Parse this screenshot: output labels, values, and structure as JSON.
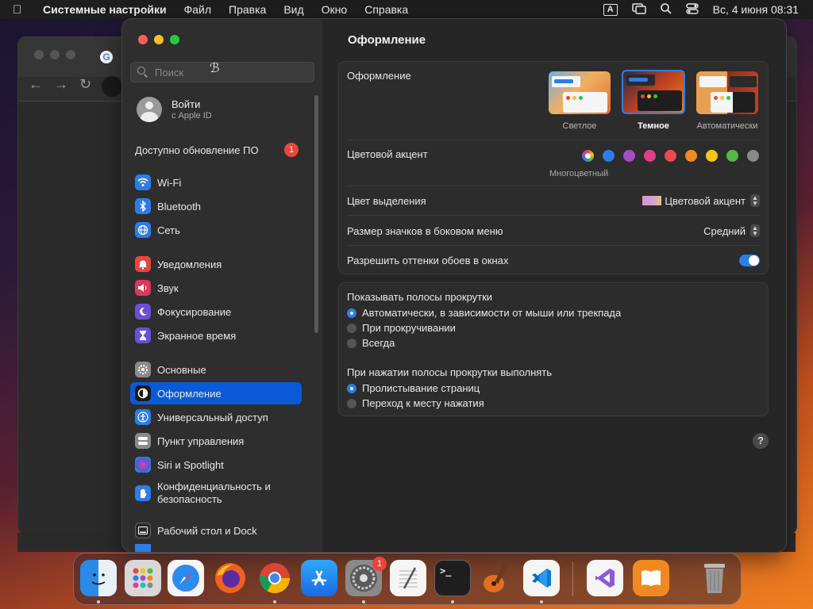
{
  "menubar": {
    "app_name": "Системные настройки",
    "items": [
      "Файл",
      "Правка",
      "Вид",
      "Окно",
      "Справка"
    ],
    "input_source": "A",
    "datetime": "Вс, 4 июня  08:31"
  },
  "sidebar": {
    "search_placeholder": "Поиск",
    "account": {
      "title": "Войти",
      "subtitle": "с Apple ID"
    },
    "update": {
      "label": "Доступно обновление ПО",
      "count": "1"
    },
    "items": [
      {
        "label": "Wi‑Fi",
        "icon": "wifi-icon",
        "color": "#2d7de8"
      },
      {
        "label": "Bluetooth",
        "icon": "bluetooth-icon",
        "color": "#2d7de8"
      },
      {
        "label": "Сеть",
        "icon": "globe-icon",
        "color": "#2d7de8"
      },
      {
        "label": "Уведомления",
        "icon": "bell-icon",
        "color": "#e8453c"
      },
      {
        "label": "Звук",
        "icon": "speaker-icon",
        "color": "#e0385a"
      },
      {
        "label": "Фокусирование",
        "icon": "moon-icon",
        "color": "#6a4fd8"
      },
      {
        "label": "Экранное время",
        "icon": "hourglass-icon",
        "color": "#6a4fd8"
      },
      {
        "label": "Основные",
        "icon": "gear-icon",
        "color": "#8a8a8a"
      },
      {
        "label": "Оформление",
        "icon": "appearance-icon",
        "color": "#1a1a1a"
      },
      {
        "label": "Универсальный доступ",
        "icon": "accessibility-icon",
        "color": "#2d7de8"
      },
      {
        "label": "Пункт управления",
        "icon": "control-center-icon",
        "color": "#8a8a8a"
      },
      {
        "label": "Siri и Spotlight",
        "icon": "siri-icon",
        "color": "#b04ad0"
      },
      {
        "label": "Конфиденциальность и безопасность",
        "icon": "hand-icon",
        "color": "#2d7de8"
      },
      {
        "label": "Рабочий стол и Dock",
        "icon": "dock-icon",
        "color": "#2a2a2a"
      }
    ]
  },
  "main": {
    "title": "Оформление",
    "appearance": {
      "label": "Оформление",
      "options": [
        "Светлое",
        "Темное",
        "Автоматически"
      ],
      "selected": "Темное"
    },
    "accent": {
      "label": "Цветовой акцент",
      "caption": "Многоцветный",
      "colors": [
        "#2d7de8",
        "#a050c0",
        "#e0408a",
        "#ec4a50",
        "#f08a20",
        "#f5c518",
        "#54b848",
        "#8a8a8a"
      ]
    },
    "highlight": {
      "label": "Цвет выделения",
      "value": "Цветовой акцент"
    },
    "sidebar_icon_size": {
      "label": "Размер значков в боковом меню",
      "value": "Средний"
    },
    "wallpaper_tinting": {
      "label": "Разрешить оттенки обоев в окнах",
      "enabled": true
    },
    "scrollbars": {
      "label": "Показывать полосы прокрутки",
      "options": [
        "Автоматически, в зависимости от мыши или трекпада",
        "При прокручивании",
        "Всегда"
      ],
      "selected": 0
    },
    "click_scrollbar": {
      "label": "При нажатии полосы прокрутки выполнять",
      "options": [
        "Пролистывание страниц",
        "Переход к месту нажатия"
      ],
      "selected": 0
    },
    "help": "?"
  },
  "dock": {
    "apps": [
      {
        "name": "Finder",
        "icon": "finder-icon"
      },
      {
        "name": "Launchpad",
        "icon": "launchpad-icon"
      },
      {
        "name": "Safari",
        "icon": "safari-icon"
      },
      {
        "name": "Firefox",
        "icon": "firefox-icon"
      },
      {
        "name": "Chrome",
        "icon": "chrome-icon"
      },
      {
        "name": "App Store",
        "icon": "app-store-icon"
      },
      {
        "name": "Системные настройки",
        "icon": "system-settings-icon",
        "badge": "1"
      },
      {
        "name": "TextEdit",
        "icon": "textedit-icon"
      },
      {
        "name": "Terminal",
        "icon": "terminal-icon"
      },
      {
        "name": "GarageBand",
        "icon": "garageband-icon"
      },
      {
        "name": "VS Code",
        "icon": "vscode-icon"
      },
      {
        "name": "Visual Studio",
        "icon": "visual-studio-icon"
      },
      {
        "name": "Books",
        "icon": "books-icon"
      },
      {
        "name": "Trash",
        "icon": "trash-icon"
      }
    ]
  }
}
